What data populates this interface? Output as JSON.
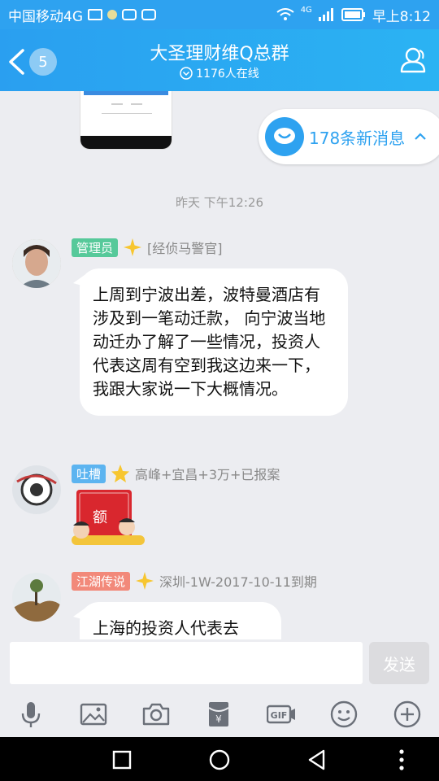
{
  "status": {
    "carrier": "中国移动4G",
    "signal_label": "4G",
    "time": "早上8:12"
  },
  "header": {
    "title": "大圣理财维Q总群",
    "unread_count": "5",
    "online": "1176人在线"
  },
  "new_messages": {
    "label": "178条新消息"
  },
  "chat": {
    "timestamp": "昨天 下午12:26",
    "messages": [
      {
        "tag": "管理员",
        "tag_color": "#56c99a",
        "sender": "[经侦马警官]",
        "text": "上周到宁波出差，波特曼酒店有涉及到一笔动迁款， 向宁波当地动迁办了解了一些情况，投资人代表这周有空到我这边来一下，我跟大家说一下大概情况。"
      },
      {
        "tag": "吐槽",
        "tag_color": "#5cb4f0",
        "sender": "高峰+宜昌+3万+已报案",
        "sticker_text": "额"
      },
      {
        "tag": "江湖传说",
        "tag_color": "#f2897a",
        "sender": "深圳-1W-2017-10-11到期",
        "text": "上海的投资人代表去"
      }
    ]
  },
  "input": {
    "placeholder": "",
    "send_label": "发送"
  },
  "toolbar": {
    "items": [
      "mic-icon",
      "image-icon",
      "camera-icon",
      "red-packet-icon",
      "gif-icon",
      "emoji-icon",
      "plus-icon"
    ]
  },
  "colors": {
    "accent": "#2ea2f0",
    "background": "#ecedf1"
  }
}
